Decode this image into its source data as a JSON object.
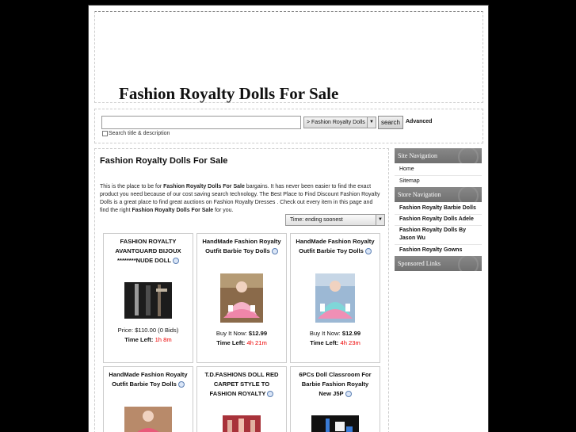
{
  "header": {
    "site_title": "Fashion Royalty Dolls For Sale"
  },
  "search": {
    "input_value": "",
    "category_selected": "> Fashion Royalty Dolls",
    "search_button": "search",
    "advanced_link": "Advanced",
    "title_desc_label": "Search title & description"
  },
  "main": {
    "title": "Fashion Royalty Dolls For Sale",
    "intro_parts": [
      "This is the place to be for ",
      "Fashion Royalty Dolls For Sale",
      " bargains. It has never been easier to find the exact product you need because of our cost saving search technology. The Best Place to Find Discount Fashion Royalty Dolls is a great place to find great auctions on Fashion Royalty Dresses . Check out every item in this page and find the right ",
      "Fashion Royalty Dolls For Sale",
      " for you."
    ],
    "sort_selected": "Time: ending soonest"
  },
  "listings": [
    {
      "title": "FASHION ROYALTY AVANTGUARD BIJOUX ********NUDE DOLL",
      "price_label": "Price:",
      "price": "$110.00 (0 Bids)",
      "time_label": "Time Left:",
      "time": "1h 8m"
    },
    {
      "title": "HandMade Fashion Royalty Outfit Barbie Toy Dolls",
      "price_label": "Buy It Now:",
      "price": "$12.99",
      "time_label": "Time Left:",
      "time": "4h 21m"
    },
    {
      "title": "HandMade Fashion Royalty Outfit Barbie Toy Dolls",
      "price_label": "Buy It Now:",
      "price": "$12.99",
      "time_label": "Time Left:",
      "time": "4h 23m"
    },
    {
      "title": "HandMade Fashion Royalty Outfit Barbie Toy Dolls"
    },
    {
      "title": "T.D.FASHIONS DOLL RED CARPET STYLE TO FASHION ROYALTY"
    },
    {
      "title": "6PCs Doll Classroom For Barbie Fashion Royalty New J5P"
    }
  ],
  "sidebar": {
    "site_nav_title": "Site Navigation",
    "site_nav": [
      "Home",
      "Sitemap"
    ],
    "store_nav_title": "Store Navigation",
    "store_nav": [
      "Fashion Royalty Barbie Dolls",
      "Fashion Royalty Dolls Adele",
      "Fashion Royalty Dolls By Jason Wu",
      "Fashion Royalty Gowns"
    ],
    "sponsored_title": "Sponsored Links"
  },
  "icons": [
    "info-bubble-icon",
    "dropdown-arrow-icon"
  ],
  "colors": {
    "time_left": "#ee0000",
    "sidebar_head": "#7a7a7a",
    "background": "#000000"
  }
}
